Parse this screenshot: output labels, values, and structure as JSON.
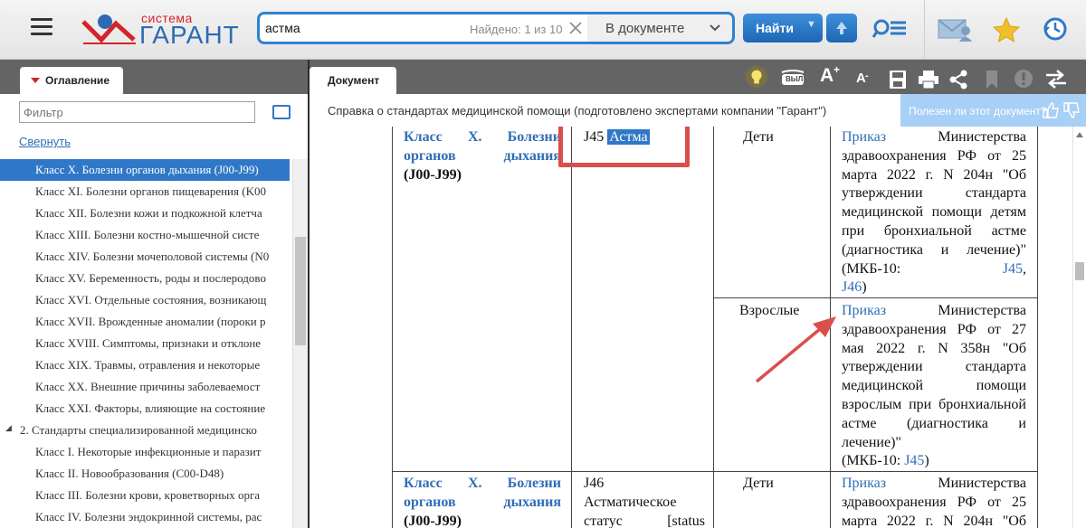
{
  "header": {
    "logo": {
      "small": "система",
      "big": "ГАРАНТ"
    },
    "search": {
      "query": "астма",
      "found": "Найдено: 1 из 10",
      "scope": "В документе"
    },
    "find_label": "Найти"
  },
  "left_panel": {
    "tab_label": "Оглавление",
    "filter_placeholder": "Фильтр",
    "collapse_label": "Свернуть",
    "toc": [
      {
        "label": "Класс X. Болезни органов дыхания (J00-J99)",
        "selected": true
      },
      {
        "label": "Класс XI. Болезни органов пищеварения (K00"
      },
      {
        "label": "Класс XII. Болезни кожи и подкожной клетча"
      },
      {
        "label": "Класс XIII. Болезни костно-мышечной систе"
      },
      {
        "label": "Класс XIV. Болезни мочеполовой системы (N0"
      },
      {
        "label": "Класс XV. Беременность, роды и послеродово"
      },
      {
        "label": "Класс XVI. Отдельные состояния, возникающ"
      },
      {
        "label": "Класс XVII. Врожденные аномалии (пороки р"
      },
      {
        "label": "Класс XVIII. Симптомы, признаки и отклоне"
      },
      {
        "label": "Класс XIX. Травмы, отравления и некоторые"
      },
      {
        "label": "Класс XX. Внешние причины заболеваемост"
      },
      {
        "label": "Класс XXI. Факторы, влияющие на состояние"
      },
      {
        "label": "2. Стандарты специализированной медицинско"
      },
      {
        "label": "Класс I. Некоторые инфекционные и паразит"
      },
      {
        "label": "Класс II. Новообразования (C00-D48)"
      },
      {
        "label": "Класс III. Болезни крови, кроветворных орга"
      },
      {
        "label": "Класс IV. Болезни эндокринной системы, рас"
      }
    ]
  },
  "document": {
    "tab_label": "Документ",
    "subtitle": "Справка о стандартах медицинской помощи (подготовлено экспертами компании \"Гарант\")",
    "helpful_text": "Полезен ли этот документ?",
    "toolbar": {
      "bvi": "ВЫЛ",
      "font_plus": "A",
      "font_minus": "A"
    },
    "table": {
      "class_col": {
        "text": "Класс X. Болезни органов дыхания",
        "last": "(J00-J99)"
      },
      "row1": {
        "code": "J45",
        "term": "Астма",
        "age_children": "Дети",
        "doc_children": {
          "link": "Приказ",
          "text": "Министерства здравоохранения РФ от 25 марта 2022 г. N 204н \"Об утверждении стандарта медицинской помощи детям при бронхиальной астме (диагностика и лечение)\" (МКБ-10:",
          "code1": "J45",
          "code2": "J46",
          "tail": ")"
        },
        "age_adults": "Взрослые",
        "doc_adults": {
          "link": "Приказ",
          "text": "Министерства здравоохранения РФ от 27 мая 2022 г. N 358н \"Об утверждении стандарта медицинской помощи взрослым при бронхиальной астме (диагностика и лечение)\"",
          "last": "(МКБ-10:",
          "code": "J45",
          "tail": ")"
        }
      },
      "row2": {
        "class_text": "Класс X. Болезни органов дыхания",
        "class_last": "(J00-J99)",
        "code": "J46",
        "name": "Астматическое статус [status",
        "age": "Дети",
        "doc": {
          "link": "Приказ",
          "text": "Министерства здравоохранения РФ от 25 марта 2022 г. N 204н \"Об"
        }
      }
    }
  },
  "colors": {
    "accent": "#2f78c8",
    "brand_red": "#d5232a",
    "annotation": "#d94f4b",
    "link": "#2f6eb5"
  }
}
